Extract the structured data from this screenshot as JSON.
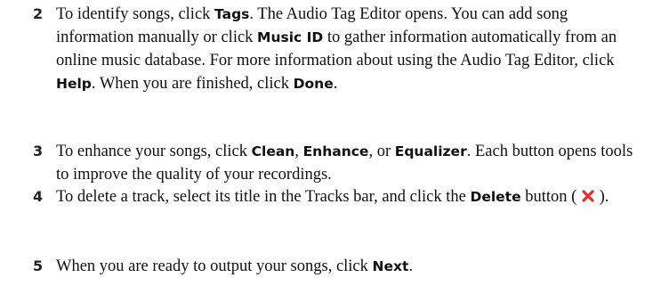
{
  "steps": [
    {
      "number": "2",
      "t1": "To identify songs, click ",
      "k1": "Tags",
      "t2": ". The Audio Tag Editor opens. You can add song information manually or click ",
      "k2": "Music ID",
      "t3": " to gather information automatically from an online music database. For more information about using the Audio Tag Editor, click ",
      "k3": "Help",
      "t4": ". When you are finished, click ",
      "k4": "Done",
      "t5": "."
    },
    {
      "number": "3",
      "t1": "To enhance your songs, click ",
      "k1": "Clean",
      "t2": ", ",
      "k2": "Enhance",
      "t3": ", or ",
      "k3": "Equalizer",
      "t4": ". Each button opens tools to improve the quality of your recordings."
    },
    {
      "number": "4",
      "t1": "To delete a track, select its title in the Tracks bar, and click the ",
      "k1": "Delete",
      "t2": " button ( ",
      "icon": "delete-x-icon",
      "icon_color": "#e0302c",
      "t3": " )."
    },
    {
      "number": "5",
      "t1": "When you are ready to output your songs, click ",
      "k1": "Next",
      "t2": "."
    }
  ]
}
